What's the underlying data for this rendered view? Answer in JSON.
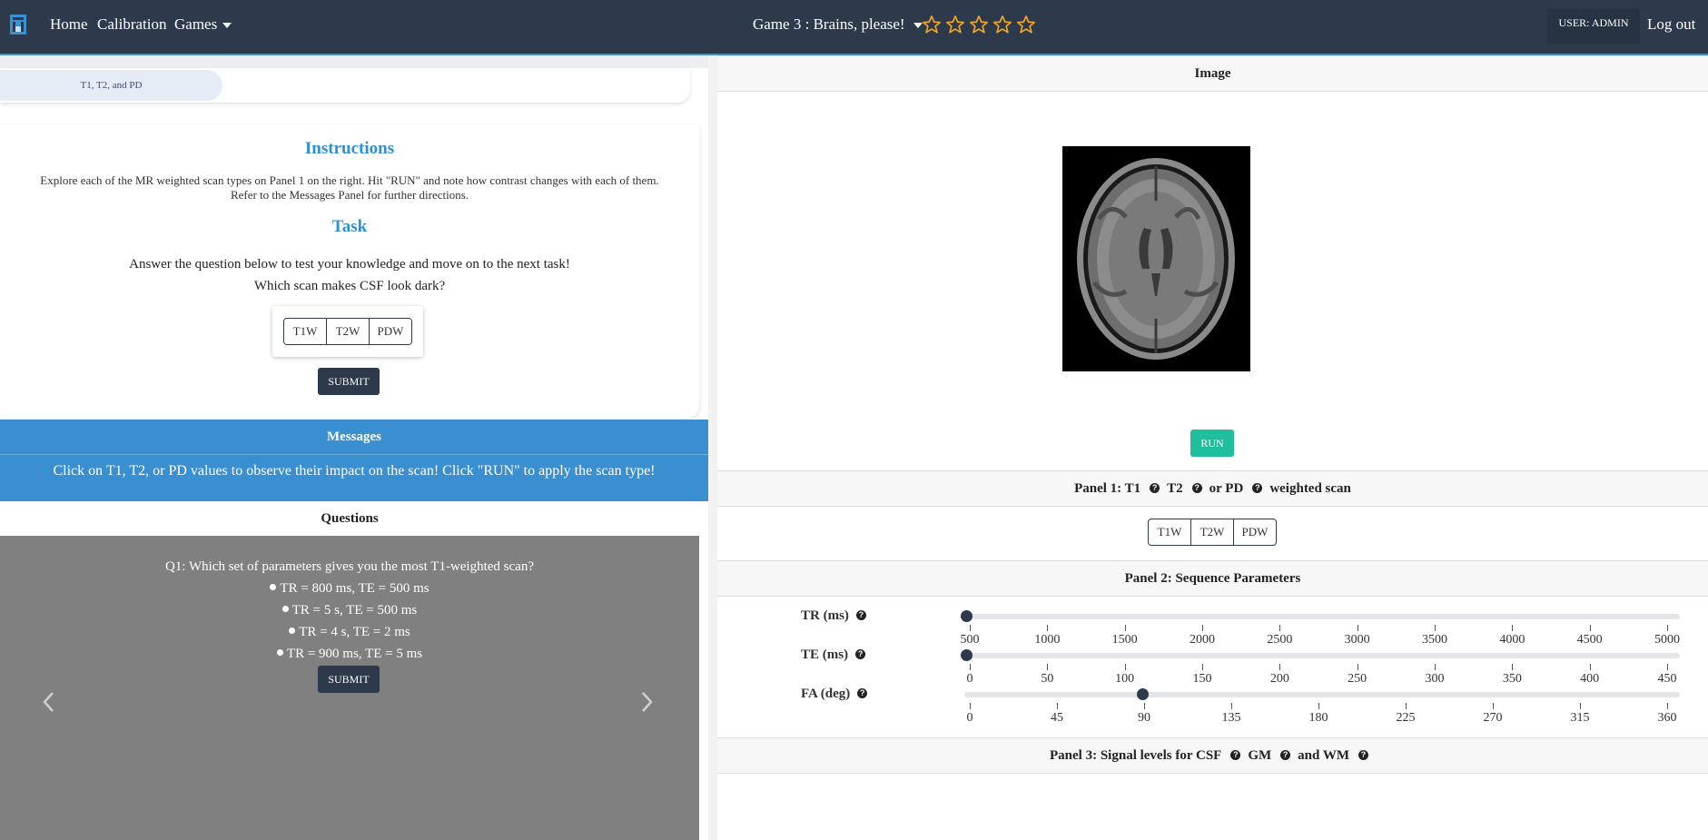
{
  "nav": {
    "home": "Home",
    "calibration": "Calibration",
    "games": "Games",
    "game_title": "Game 3 : Brains, please!",
    "star_count": 5,
    "stars_filled": 0,
    "star_color": "#f5a623",
    "user": "USER: ADMIN",
    "logout": "Log out"
  },
  "tabs": [
    "T1, T2, and PD"
  ],
  "instructions": {
    "title": "Instructions",
    "text_line1": "Explore each of the MR weighted scan types on Panel 1 on the right. Hit \"RUN\" and note how contrast changes with each of them.",
    "text_line2": "Refer to the Messages Panel for further directions.",
    "task_title": "Task",
    "task_line1": "Answer the question below to test your knowledge and move on to the next task!",
    "task_line2": "Which scan makes CSF look dark?",
    "options": [
      "T1W",
      "T2W",
      "PDW"
    ],
    "submit": "SUBMIT"
  },
  "messages": {
    "title": "Messages",
    "text": "Click on T1, T2, or PD values to observe their impact on the scan! Click \"RUN\" to apply the scan type!"
  },
  "questions": {
    "title": "Questions",
    "q1": "Q1: Which set of parameters gives you the most T1-weighted scan?",
    "options": [
      "TR = 800 ms, TE = 500 ms",
      "TR = 5 s, TE = 500 ms",
      "TR = 4 s, TE = 2 ms",
      "TR = 900 ms, TE = 5 ms"
    ],
    "submit": "SUBMIT"
  },
  "image_panel": {
    "title": "Image",
    "run": "RUN"
  },
  "panel1": {
    "prefix": "Panel 1: T1",
    "t2": "T2",
    "pd": "or PD",
    "suffix": "weighted scan",
    "options": [
      "T1W",
      "T2W",
      "PDW"
    ]
  },
  "panel2": {
    "title": "Panel 2: Sequence Parameters",
    "sliders": [
      {
        "label": "TR (ms)",
        "value": 500,
        "min": 500,
        "max": 5000,
        "ticks": [
          "500",
          "1000",
          "1500",
          "2000",
          "2500",
          "3000",
          "3500",
          "4000",
          "4500",
          "5000"
        ]
      },
      {
        "label": "TE (ms)",
        "value": 0,
        "min": 0,
        "max": 450,
        "ticks": [
          "0",
          "50",
          "100",
          "150",
          "200",
          "250",
          "300",
          "350",
          "400",
          "450"
        ]
      },
      {
        "label": "FA (deg)",
        "value": 90,
        "min": 0,
        "max": 360,
        "ticks": [
          "0",
          "45",
          "90",
          "135",
          "180",
          "225",
          "270",
          "315",
          "360"
        ]
      }
    ]
  },
  "panel3": {
    "prefix": "Panel 3: Signal levels for CSF",
    "gm": "GM",
    "wm": "and WM"
  },
  "colors": {
    "navbar": "#2d3a4b",
    "accent_blue": "#3a8fd0",
    "run_green": "#1fbf9d"
  }
}
